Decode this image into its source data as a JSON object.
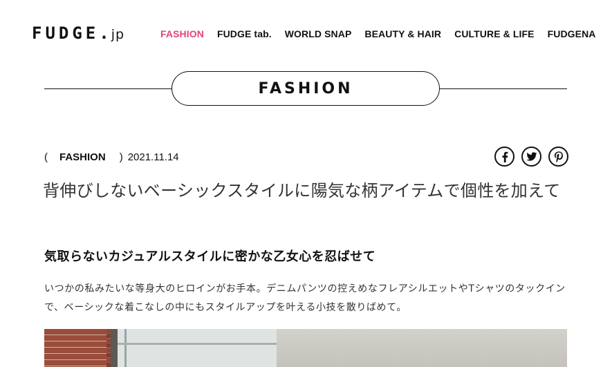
{
  "site": {
    "logo_main": "FUDGE.",
    "logo_sub": "jp"
  },
  "nav": {
    "items": [
      {
        "label": "FASHION",
        "active": true
      },
      {
        "label": "FUDGE tab.",
        "active": false
      },
      {
        "label": "WORLD SNAP",
        "active": false
      },
      {
        "label": "BEAUTY & HAIR",
        "active": false
      },
      {
        "label": "CULTURE & LIFE",
        "active": false
      },
      {
        "label": "FUDGENA",
        "active": false
      }
    ]
  },
  "section": {
    "title": "FASHION"
  },
  "article": {
    "paren_open": "(",
    "category": "FASHION",
    "paren_close": ")",
    "date": "2021.11.14",
    "title": "背伸びしないベーシックスタイルに陽気な柄アイテムで個性を加えて",
    "subtitle": "気取らないカジュアルスタイルに密かな乙女心を忍ばせて",
    "body": "いつかの私みたいな等身大のヒロインがお手本。デニムパンツの控えめなフレアシルエットやTシャツのタックインで、ベーシックな着こなしの中にもスタイルアップを叶える小技を散りばめて。"
  },
  "share": {
    "icons": [
      "facebook-icon",
      "twitter-icon",
      "pinterest-icon"
    ]
  },
  "colors": {
    "accent": "#e0457b",
    "text": "#111111"
  }
}
